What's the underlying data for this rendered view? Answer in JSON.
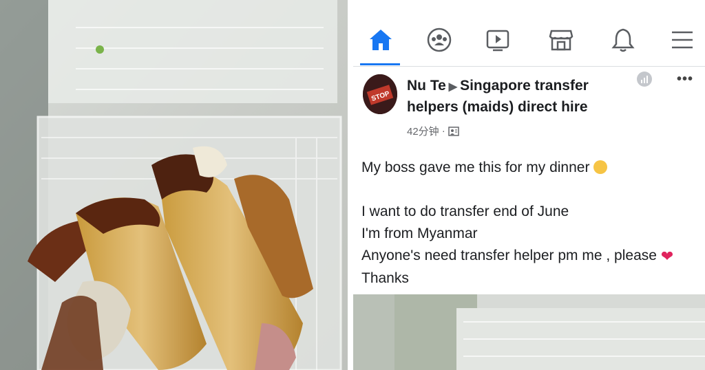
{
  "navbar": {
    "items": [
      {
        "name": "home",
        "icon": "home-icon",
        "active": true
      },
      {
        "name": "groups",
        "icon": "groups-icon",
        "active": false
      },
      {
        "name": "watch",
        "icon": "video-icon",
        "active": false
      },
      {
        "name": "marketplace",
        "icon": "store-icon",
        "active": false
      },
      {
        "name": "notifications",
        "icon": "bell-icon",
        "active": false
      },
      {
        "name": "menu",
        "icon": "menu-icon",
        "active": false
      }
    ],
    "accent_color": "#1877f2"
  },
  "post": {
    "author": "Nu Te",
    "group": "Singapore transfer helpers (maids) direct hire",
    "time": "42分钟",
    "separator": "·",
    "avatar_text": "STOP",
    "lines": [
      "My boss gave me this for my dinner",
      "I want to do transfer end of June",
      "I'm from Myanmar",
      "Anyone's need transfer helper pm me , please",
      "Thanks"
    ]
  }
}
